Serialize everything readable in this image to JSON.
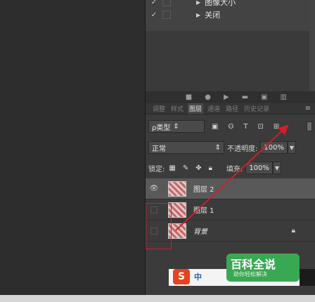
{
  "actions": [
    {
      "checked": "✓",
      "label": "图像大小"
    },
    {
      "checked": "✓",
      "label": "关闭"
    }
  ],
  "panel_tabs": [
    "调整",
    "样式",
    "图层",
    "通道",
    "路径",
    "历史记录"
  ],
  "active_tab": "图层",
  "filter": {
    "kind_label": "ρ类型",
    "icons": [
      "▣",
      "ʘ",
      "T",
      "⊡",
      "⊞"
    ]
  },
  "blend": {
    "mode": "正常",
    "opacity_label": "不透明度:",
    "opacity": "100%"
  },
  "lock": {
    "label": "锁定:",
    "fill_label": "填充:",
    "fill": "100%"
  },
  "layers": [
    {
      "name": "图层 2",
      "visible": true,
      "selected": true
    },
    {
      "name": "图层 1",
      "visible": false,
      "selected": false
    },
    {
      "name": "背景",
      "visible": false,
      "selected": false,
      "locked": true
    }
  ],
  "watermark": {
    "brand": "百科全说",
    "slogan": "助你轻松解决",
    "ime": "中"
  },
  "colors": {
    "highlight": "#d41e2a",
    "panel": "#3b3b3b",
    "selected": "#595959"
  }
}
